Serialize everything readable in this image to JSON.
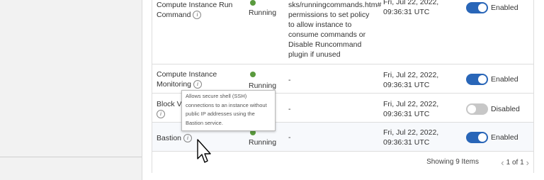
{
  "rows": [
    {
      "name": "Compute Instance Run Command",
      "status": "Running",
      "description": "sks/runningcommands.htm# permissions to set policy to allow instance to consume commands or Disable Runcommand plugin if unused",
      "date": "Fri, Jul 22, 2022, 09:36:31 UTC",
      "toggle": "Enabled"
    },
    {
      "name": "Compute Instance Monitoring",
      "status": "Running",
      "description": "-",
      "date": "Fri, Jul 22, 2022, 09:36:31 UTC",
      "toggle": "Enabled"
    },
    {
      "name": "Block Vo",
      "status": "",
      "description": "-",
      "date": "Fri, Jul 22, 2022, 09:36:31 UTC",
      "toggle": "Disabled"
    },
    {
      "name": "Bastion",
      "status": "Running",
      "description": "-",
      "date": "Fri, Jul 22, 2022, 09:36:31 UTC",
      "toggle": "Enabled"
    }
  ],
  "tooltip": "Allows secure shell (SSH) connections to an instance without public IP addresses using the Bastion service.",
  "footer": {
    "showing": "Showing 9 Items",
    "page": "1 of 1"
  },
  "colors": {
    "toggle_on": "#2966b8",
    "toggle_off": "#c7c7c7",
    "running_dot": "#5a9a3e"
  }
}
